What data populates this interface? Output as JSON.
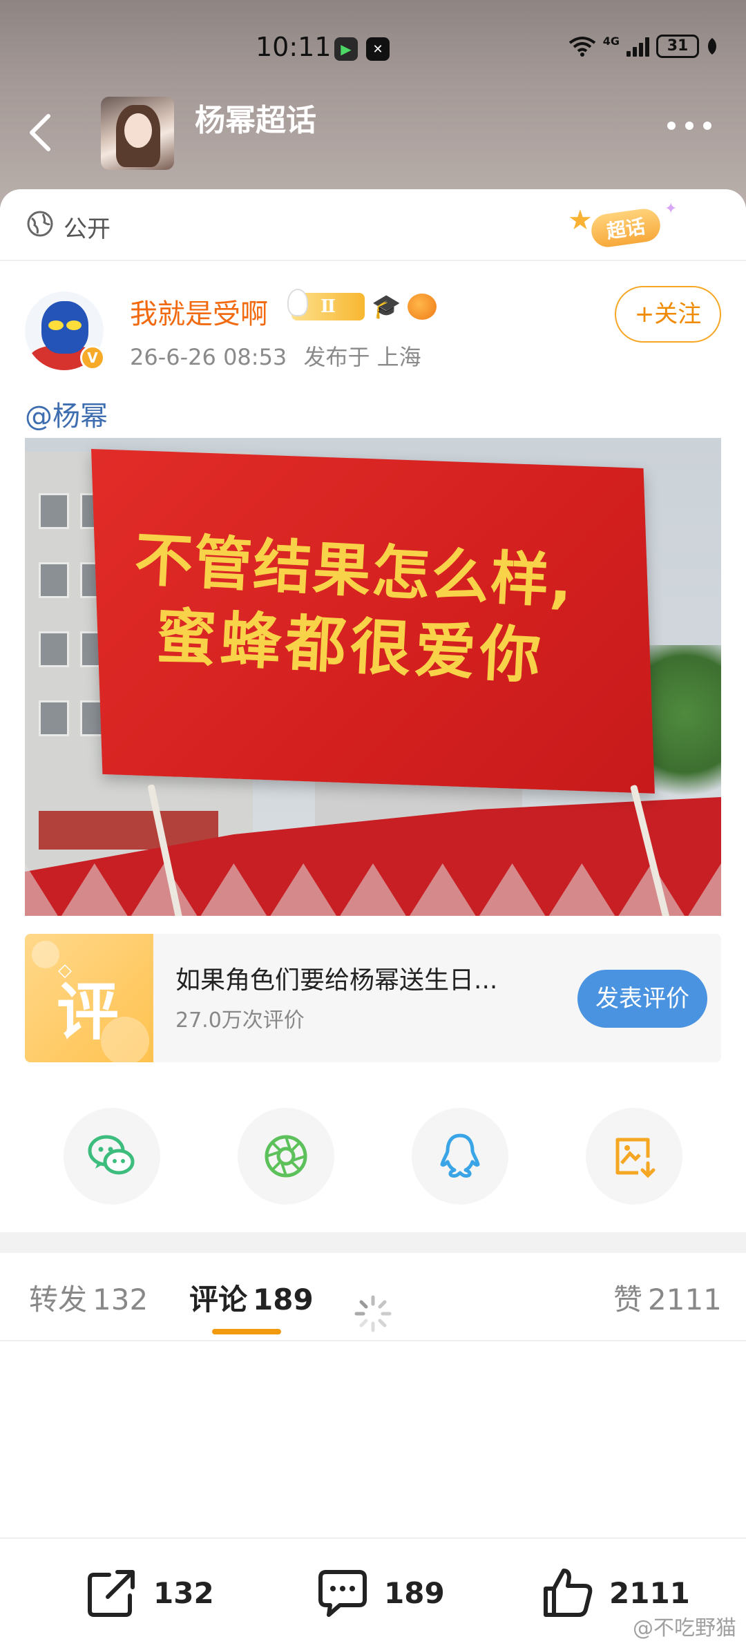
{
  "status_bar": {
    "time": "10:11",
    "network_label": "4G",
    "battery": "31",
    "icons": [
      "video-app-icon",
      "capcut-icon",
      "wifi-icon",
      "signal-icon",
      "battery-icon",
      "leaf-icon"
    ]
  },
  "nav": {
    "title": "杨幂超话",
    "back_icon": "chevron-left-icon",
    "more_icon": "more-dots-icon"
  },
  "visibility": {
    "label": "公开",
    "icon": "globe-icon",
    "topic_badge": "超话"
  },
  "author": {
    "name": "我就是受啊",
    "level_badge": "Ⅱ",
    "verified_mark": "V",
    "time": "26-6-26 08:53",
    "location": "发布于 上海",
    "follow_label": "+关注"
  },
  "post": {
    "mention": "@杨幂",
    "image_text_line1": "不管结果怎么样,",
    "image_text_line2": "蜜蜂都很爱你"
  },
  "review_card": {
    "thumb_label": "评",
    "title": "如果角色们要给杨幂送生日...",
    "count": "27.0万次评价",
    "button_label": "发表评价"
  },
  "share": {
    "items": [
      "wechat-icon",
      "moments-icon",
      "qq-icon",
      "save-image-icon"
    ]
  },
  "tabs": {
    "repost_label": "转发",
    "repost_count": "132",
    "comment_label": "评论",
    "comment_count": "189",
    "like_label": "赞",
    "like_count": "2111"
  },
  "bottom_bar": {
    "repost_count": "132",
    "comment_count": "189",
    "like_count": "2111"
  },
  "watermark": "@不吃野猫",
  "colors": {
    "accent_orange": "#f29a0e",
    "author_name": "#f26a10",
    "mention_blue": "#3e6eb0",
    "button_blue": "#4a93e0",
    "banner_red": "#d3201f",
    "banner_text": "#f8d34a"
  }
}
